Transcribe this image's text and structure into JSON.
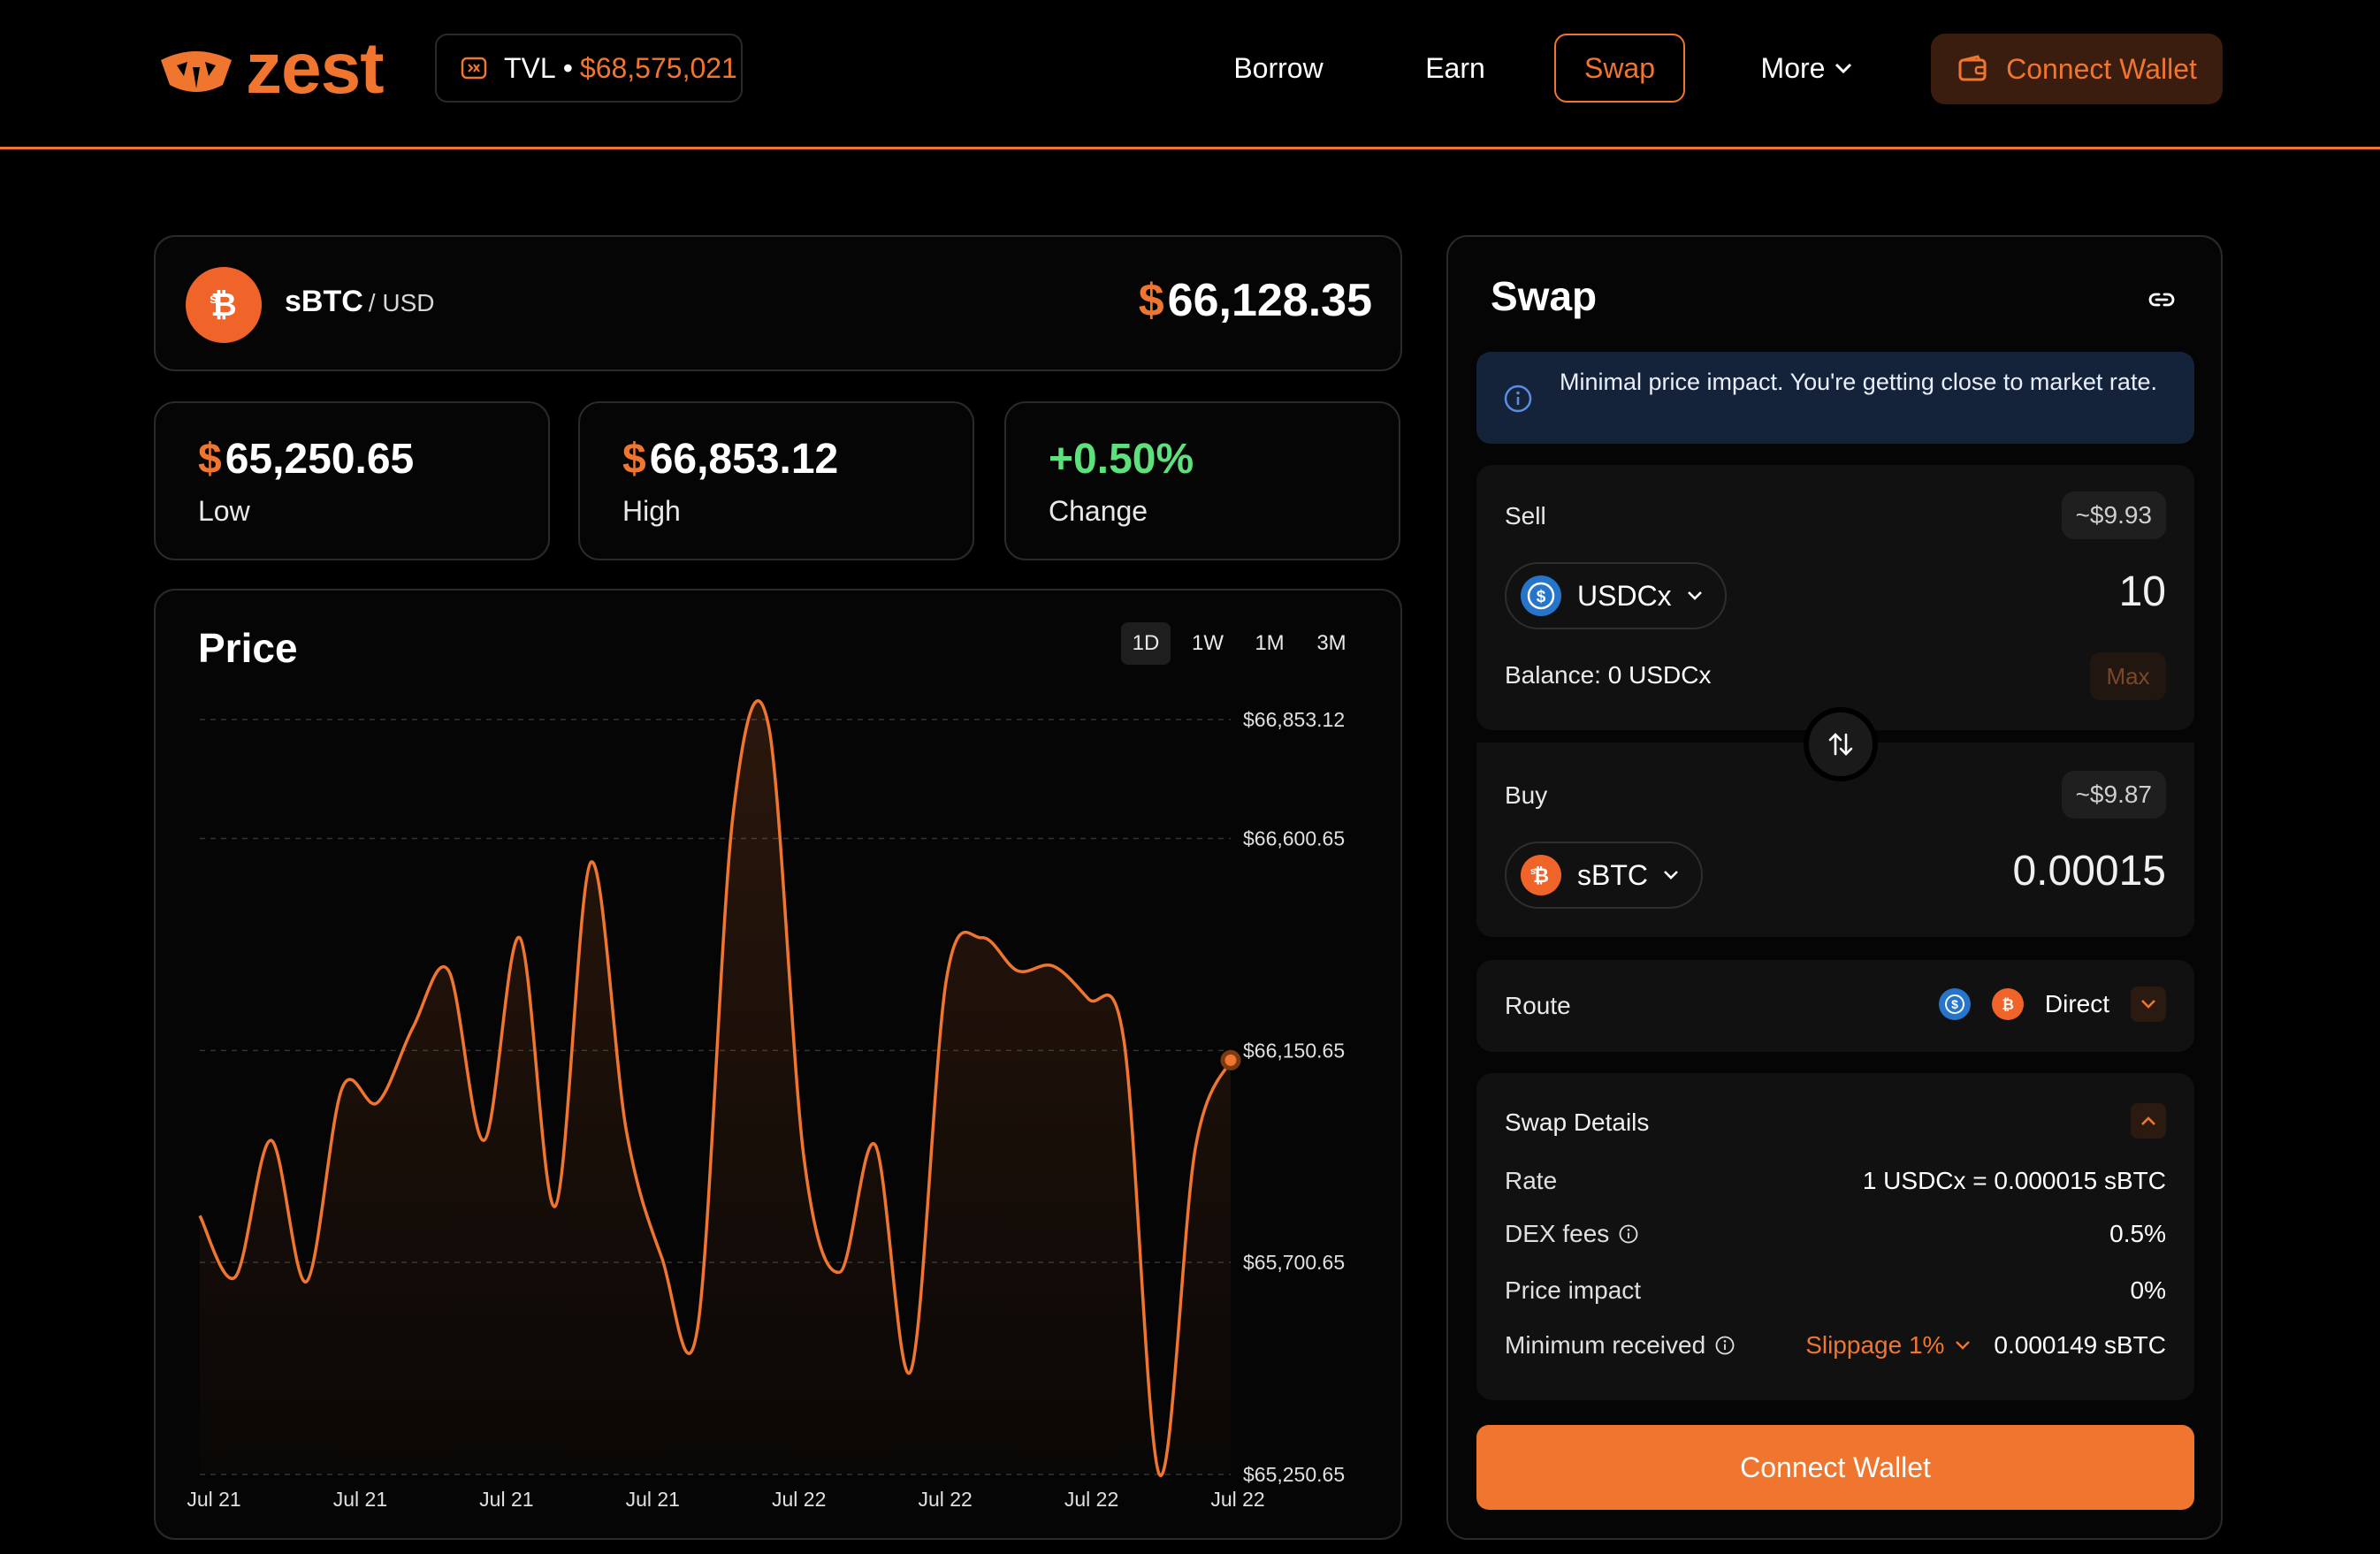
{
  "header": {
    "logo_text": "zest",
    "tvl_label": "TVL",
    "tvl_separator": "•",
    "tvl_value": "$68,575,021",
    "nav": {
      "borrow": "Borrow",
      "earn": "Earn",
      "swap": "Swap",
      "more": "More"
    },
    "connect_wallet": "Connect Wallet"
  },
  "pair": {
    "base": "sBTC",
    "quote": "/ USD",
    "currency_symbol": "$",
    "price": "66,128.35"
  },
  "stats": [
    {
      "symbol": "$",
      "value": "65,250.65",
      "label": "Low"
    },
    {
      "symbol": "$",
      "value": "66,853.12",
      "label": "High"
    },
    {
      "value": "+0.50%",
      "label": "Change"
    }
  ],
  "chart_panel": {
    "title": "Price",
    "timeframes": [
      "1D",
      "1W",
      "1M",
      "3M"
    ],
    "active_timeframe": "1D"
  },
  "chart_data": {
    "type": "area",
    "title": "Price",
    "y_tick_labels": [
      "$66,853.12",
      "$66,600.65",
      "$66,150.65",
      "$65,700.65",
      "$65,250.65"
    ],
    "y_ticks": [
      66853.12,
      66600.65,
      66150.65,
      65700.65,
      65250.65
    ],
    "ylim": [
      65250.65,
      66853.12
    ],
    "x_tick_labels": [
      "Jul 21",
      "Jul 21",
      "Jul 21",
      "Jul 21",
      "Jul 22",
      "Jul 22",
      "Jul 22",
      "Jul 22"
    ],
    "grid": true,
    "color": "#f07630",
    "values": [
      65800,
      65670,
      65960,
      65660,
      66070,
      66040,
      66200,
      66320,
      65960,
      66390,
      65820,
      66550,
      65980,
      65710,
      65560,
      66650,
      66840,
      65920,
      65680,
      65950,
      65470,
      66300,
      66390,
      66320,
      66330,
      66260,
      66170,
      65250,
      65940,
      66130
    ]
  },
  "swap": {
    "title": "Swap",
    "info_text": "Minimal price impact. You're getting close to market rate.",
    "sell": {
      "label": "Sell",
      "usd_value": "~$9.93",
      "token": "USDCx",
      "amount": "10",
      "balance_label": "Balance:",
      "balance_value": "0 USDCx",
      "max_label": "Max"
    },
    "buy": {
      "label": "Buy",
      "usd_value": "~$9.87",
      "token": "sBTC",
      "amount": "0.00015"
    },
    "route": {
      "label": "Route",
      "value": "Direct"
    },
    "details": {
      "title": "Swap Details",
      "rows": [
        {
          "label": "Rate",
          "value": "1 USDCx = 0.000015 sBTC"
        },
        {
          "label": "DEX fees",
          "value": "0.5%"
        },
        {
          "label": "Price impact",
          "value": "0%"
        },
        {
          "label": "Minimum received",
          "value": "0.000149 sBTC",
          "slippage": "Slippage 1%"
        }
      ]
    },
    "connect_wallet": "Connect Wallet"
  },
  "colors": {
    "accent": "#f07630",
    "positive": "#5ee07d",
    "usdc_blue": "#2775ca",
    "info_bg": "#15233a"
  },
  "icons": [
    "logo-mascot-icon",
    "tvl-icon",
    "chevron-down-icon",
    "wallet-icon",
    "btc-icon",
    "link-icon",
    "info-icon",
    "usdc-icon",
    "swap-arrows-icon",
    "chevron-up-icon"
  ]
}
